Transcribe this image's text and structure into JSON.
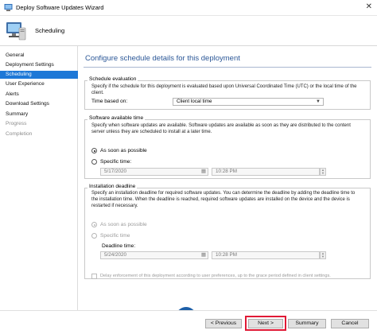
{
  "window": {
    "title": "Deploy Software Updates Wizard",
    "close_glyph": "✕"
  },
  "header": {
    "title": "Scheduling"
  },
  "sidebar": {
    "items": [
      {
        "label": "General"
      },
      {
        "label": "Deployment Settings"
      },
      {
        "label": "Scheduling"
      },
      {
        "label": "User Experience"
      },
      {
        "label": "Alerts"
      },
      {
        "label": "Download Settings"
      },
      {
        "label": "Summary"
      },
      {
        "label": "Progress"
      },
      {
        "label": "Completion"
      }
    ]
  },
  "page": {
    "title": "Configure schedule details for this deployment",
    "schedule_evaluation": {
      "label": "Schedule evaluation",
      "description": "Specify if the schedule for this deployment is evaluated based upon Universal Coordinated Time (UTC) or the local time of the client.",
      "time_based_on_label": "Time based on:",
      "time_based_on_value": "Client local time"
    },
    "software_available": {
      "label": "Software available time",
      "description": "Specify when software updates are available. Software updates are available as soon as they are distributed to the content server unless they are scheduled to install at a later time.",
      "asap_label": "As soon as possible",
      "specific_label": "Specific time:",
      "date": "5/17/2020",
      "time": "10:28 PM"
    },
    "installation_deadline": {
      "label": "Installation deadline",
      "description": "Specify an installation deadline for required software updates. You can determine the deadline by adding the deadline time to the installation time. When the deadline is reached, required software updates are installed on the device and the device is restarted if necessary.",
      "asap_label": "As soon as possible",
      "specific_label": "Specific time",
      "deadline_time_label": "Deadline time:",
      "date": "5/24/2020",
      "time": "10:28 PM",
      "delay_label": "Delay enforcement of this deployment according to user preferences, up to the grace period defined in client settings."
    }
  },
  "footer": {
    "previous_label": "< Previous",
    "next_label": "Next >",
    "summary_label": "Summary",
    "cancel_label": "Cancel"
  },
  "colors": {
    "accent": "#1e78d7",
    "page_title": "#2b5797",
    "highlight": "#e01a36"
  },
  "icons": {
    "app": "wizard-app-icon",
    "header": "computer-setup-icon",
    "logo": "p-logo",
    "calendar": "calendar-icon",
    "dropdown": "chevron-down-icon"
  }
}
